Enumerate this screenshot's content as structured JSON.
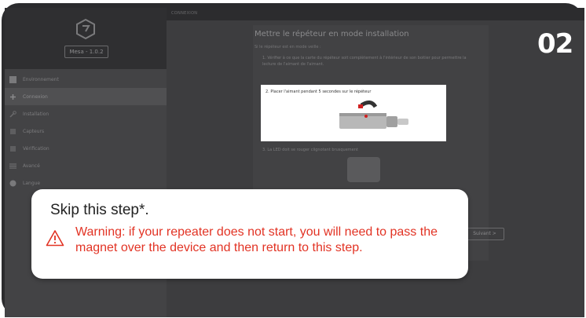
{
  "step_number": "02",
  "topbar": {
    "label": "CONNEXION"
  },
  "sidebar": {
    "version_button": "Mesa - 1.0.2",
    "items": [
      {
        "label": "Environnement",
        "icon": "grid-icon",
        "active": false
      },
      {
        "label": "Connexion",
        "icon": "plus-icon",
        "active": true
      },
      {
        "label": "Installation",
        "icon": "wrench-icon",
        "active": false
      },
      {
        "label": "Capteurs",
        "icon": "sensor-icon",
        "active": false
      },
      {
        "label": "Vérification",
        "icon": "check-icon",
        "active": false
      },
      {
        "label": "Avancé",
        "icon": "sliders-icon",
        "active": false
      },
      {
        "label": "Langue",
        "icon": "globe-icon",
        "active": false
      }
    ]
  },
  "panel": {
    "title": "Mettre le répéteur en mode installation",
    "subtitle": "Si le répéteur est en mode veille :",
    "step1": "1. Vérifier à ce que la carte du répéteur soit complètement à l'intérieur de son boitier pour permettre la lecture de l'aimant de l'aimant.",
    "step2_caption": "2. Placer l'aimant pendant 5 secondes sur le répéteur",
    "step3": "3. La LED doit se rouger clignotant brusquement",
    "next_button": "Suivant >"
  },
  "callout": {
    "title": "Skip this step*.",
    "warning": "Warning: if your repeater does not start, you will need to pass the magnet over the device and then return to this step."
  },
  "colors": {
    "warning": "#e23324",
    "frame": "#2b2b2d",
    "sidebar": "#434345"
  }
}
